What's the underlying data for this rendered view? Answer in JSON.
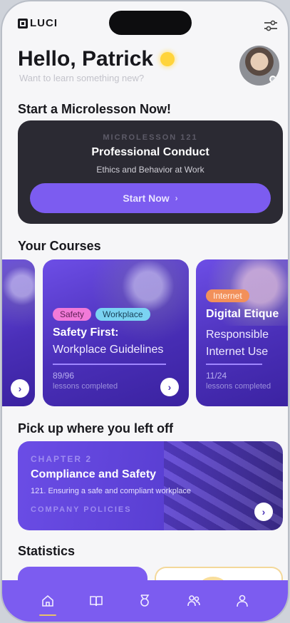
{
  "brand": {
    "logo_text": "LUCI"
  },
  "header": {
    "greeting": "Hello, Patrick",
    "subtitle": "Want to learn something new?"
  },
  "microlesson_section": {
    "title": "Start a Microlesson Now!",
    "card": {
      "kicker": "MICROLESSON 121",
      "title": "Professional Conduct",
      "subtitle": "Ethics and Behavior at Work",
      "button_label": "Start Now",
      "button_chevron": "›"
    }
  },
  "courses_section": {
    "title": "Your Courses",
    "courses": [
      {
        "tags": [
          "Safety",
          "Workplace"
        ],
        "title": "Safety First:",
        "subtitle": "Workplace Guidelines",
        "progress_text": "89/96",
        "progress_label": "lessons completed",
        "progress": 0.927
      },
      {
        "tags": [
          "Internet"
        ],
        "title": "Digital Etique",
        "subtitle": "Responsible Internet Use",
        "progress_text": "11/24",
        "progress_label": "lessons completed",
        "progress": 0.458
      }
    ],
    "card_button_icon": "›"
  },
  "continue_section": {
    "title": "Pick up where you left off",
    "card": {
      "kicker": "CHAPTER 2",
      "title": "Compliance and Safety",
      "subtitle": "121. Ensuring a safe and compliant workplace",
      "category": "COMPANY POLICIES",
      "button_icon": "›"
    }
  },
  "statistics_section": {
    "title": "Statistics"
  },
  "nav": {
    "items": [
      {
        "icon": "home-icon",
        "active": true
      },
      {
        "icon": "book-icon",
        "active": false
      },
      {
        "icon": "medal-icon",
        "active": false
      },
      {
        "icon": "team-icon",
        "active": false
      },
      {
        "icon": "profile-icon",
        "active": false
      }
    ]
  },
  "colors": {
    "accent": "#7c5cf0",
    "dark_card": "#2b2a33",
    "tag_safety": "#f27ad8",
    "tag_workplace": "#7ad3f2",
    "tag_internet": "#f2905a",
    "sun": "#ffd43b"
  }
}
